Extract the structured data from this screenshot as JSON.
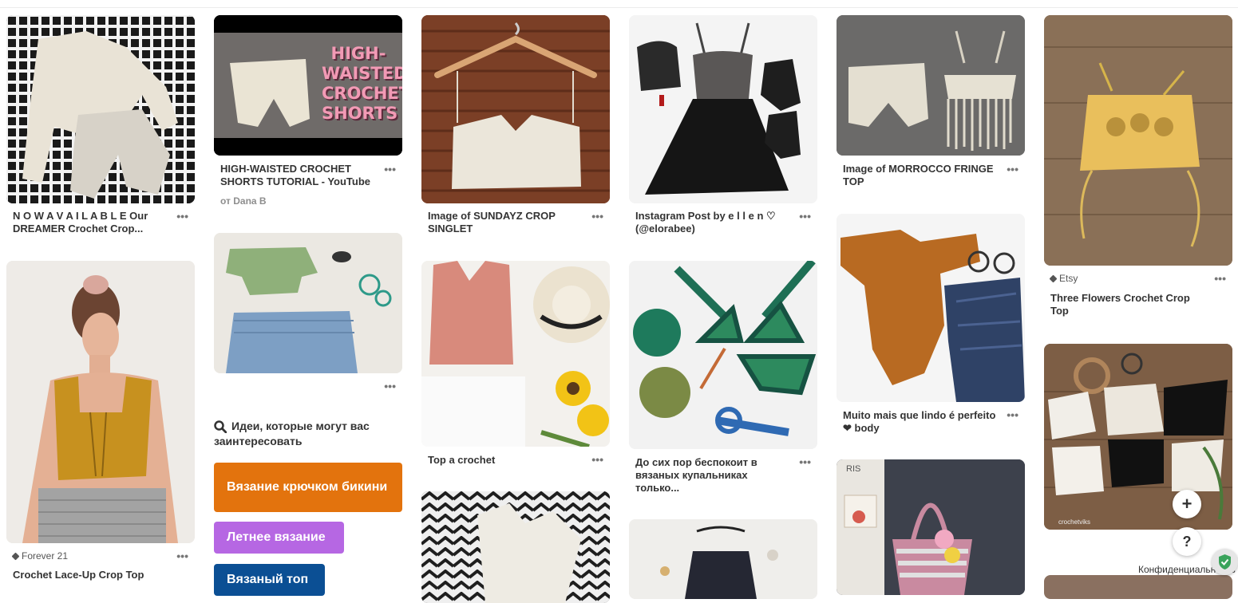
{
  "col1": {
    "pin1_caption": "N O W A V A I L A B L E Our DREAMER Crochet Crop...",
    "pin2_source": "Forever 21",
    "pin2_caption": "Crochet Lace-Up Crop Top"
  },
  "col2": {
    "video_title_line1": "HIGH-",
    "video_title_line2": "WAISTED",
    "video_title_line3": "CROCHET",
    "video_title_line4": "SHORTS",
    "pin1_caption": "HIGH-WAISTED CROCHET SHORTS TUTORIAL - YouTube",
    "pin1_author": "от Dana B",
    "ideas_heading": "Идеи, которые могут вас заинтересовать",
    "chip1": "Вязание крючком бикини",
    "chip2": "Летнее вязание",
    "chip3": "Вязаный топ"
  },
  "col3": {
    "pin1_caption": "Image of SUNDAYZ CROP SINGLET",
    "pin2_caption": "Top a crochet"
  },
  "col4": {
    "pin1_caption": "Instagram Post by e l l e n ♡ (@elorabee)",
    "pin2_caption": "До сих пор беспокоит в вязаных купальниках только..."
  },
  "col5": {
    "pin1_caption": "Image of MORROCCO FRINGE TOP",
    "pin2_caption": "Muito mais que lindo é perfeito ❤ body",
    "pin3_text": "RIS"
  },
  "col6": {
    "pin1_source": "Etsy",
    "pin1_caption": "Three Flowers Crochet Crop Top",
    "pin2_watermark": "crochetviks"
  },
  "ui": {
    "more_label": "•••",
    "add_button": "+",
    "help_button": "?",
    "privacy_label": "Конфиденциальность"
  },
  "colors": {
    "chip1": "#e3730d",
    "chip2": "#b667e3",
    "chip3": "#0b4f94",
    "text": "#333333",
    "muted": "#8e8e8e"
  }
}
